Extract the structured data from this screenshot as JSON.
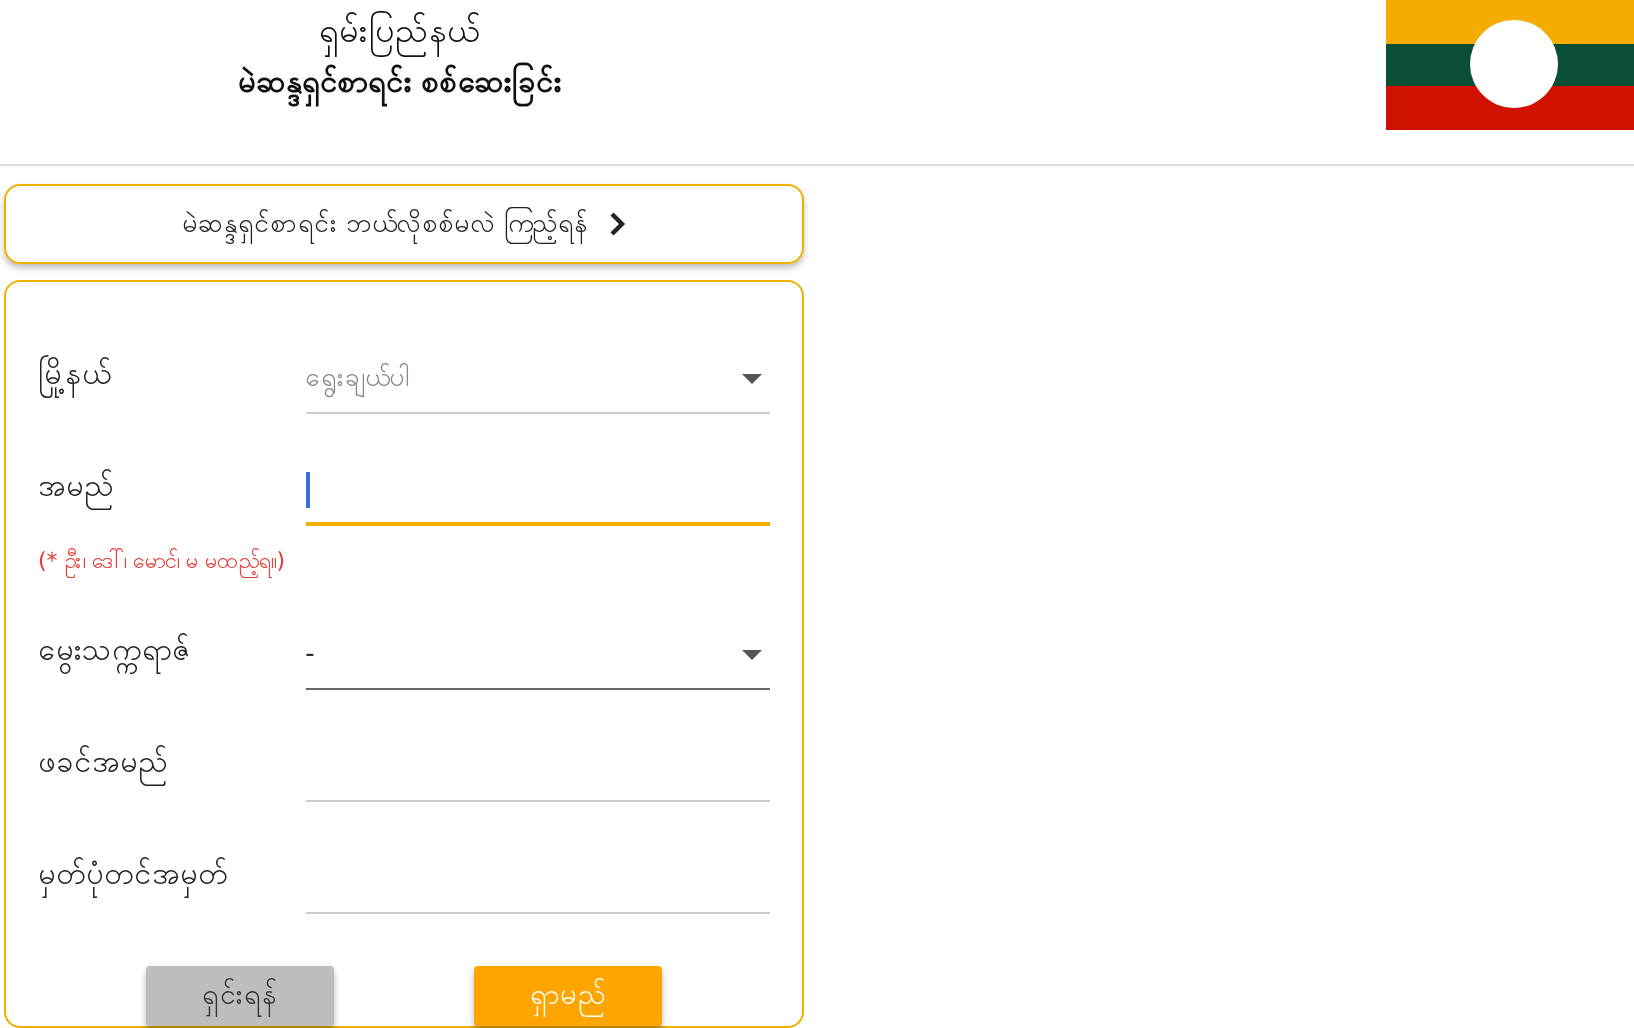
{
  "header": {
    "title": "ရှမ်းပြည်နယ်",
    "subtitle": "မဲဆန္ဒရှင်စာရင်း စစ်ဆေးခြင်း"
  },
  "guide_link": {
    "label": "မဲဆန္ဒရှင်စာရင်း ဘယ်လိုစစ်မလဲ ကြည့်ရန်"
  },
  "form": {
    "fields": [
      {
        "kind": "select",
        "label": "မြို့နယ်",
        "placeholder": "ရွေးချယ်ပါ",
        "focused": false
      },
      {
        "kind": "text",
        "label": "အမည်",
        "focused": true,
        "hint": "(* ဦး၊ ဒေါ်၊ မောင်၊ မ  မထည့်ရ။)"
      },
      {
        "kind": "select",
        "label": "မွေးသက္ကရာဇ်",
        "value": "-",
        "focused": false
      },
      {
        "kind": "text",
        "label": "ဖခင်အမည်",
        "focused": false
      },
      {
        "kind": "text",
        "label": "မှတ်ပုံတင်အမှတ်",
        "focused": false
      }
    ],
    "buttons": [
      {
        "label": "ရှင်းရန်",
        "kind": "secondary"
      },
      {
        "label": "ရှာမည်",
        "kind": "primary"
      }
    ]
  }
}
